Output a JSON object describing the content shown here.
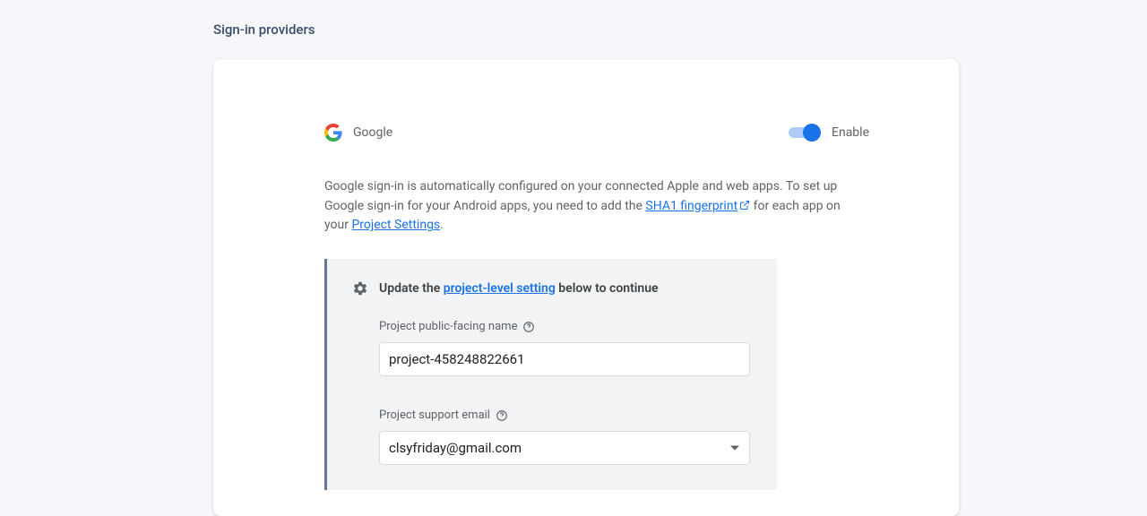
{
  "page": {
    "title": "Sign-in providers"
  },
  "provider": {
    "name": "Google",
    "toggle_label": "Enable"
  },
  "description": {
    "part1": "Google sign-in is automatically configured on your connected Apple and web apps. To set up Google sign-in for your Android apps, you need to add the ",
    "link1": "SHA1 fingerprint",
    "part2": " for each app on your ",
    "link2": "Project Settings",
    "part3": "."
  },
  "panel": {
    "header_pre": "Update the ",
    "header_link": "project-level setting",
    "header_post": " below to continue",
    "field1": {
      "label": "Project public-facing name",
      "value": "project-458248822661"
    },
    "field2": {
      "label": "Project support email",
      "value": "clsyfriday@gmail.com"
    }
  }
}
